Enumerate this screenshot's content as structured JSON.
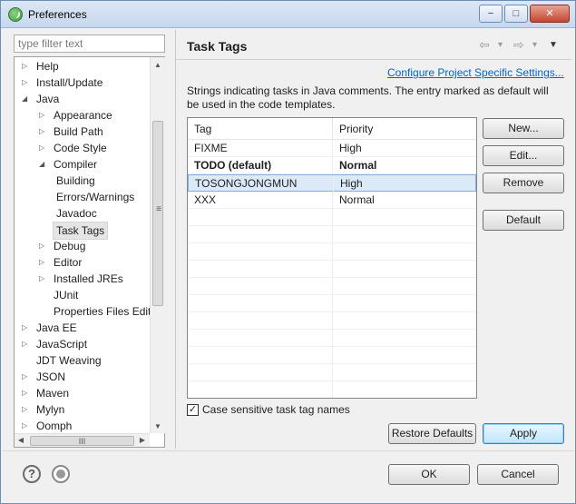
{
  "window": {
    "title": "Preferences"
  },
  "left_pane": {
    "filter_placeholder": "type filter text",
    "tree": [
      {
        "label": "Help",
        "arrow": "▷",
        "level": 0
      },
      {
        "label": "Install/Update",
        "arrow": "▷",
        "level": 0
      },
      {
        "label": "Java",
        "arrow": "◢",
        "level": 0
      },
      {
        "label": "Appearance",
        "arrow": "▷",
        "level": 1
      },
      {
        "label": "Build Path",
        "arrow": "▷",
        "level": 1
      },
      {
        "label": "Code Style",
        "arrow": "▷",
        "level": 1
      },
      {
        "label": "Compiler",
        "arrow": "◢",
        "level": 1
      },
      {
        "label": "Building",
        "arrow": "",
        "level": 2
      },
      {
        "label": "Errors/Warnings",
        "arrow": "",
        "level": 2
      },
      {
        "label": "Javadoc",
        "arrow": "",
        "level": 2
      },
      {
        "label": "Task Tags",
        "arrow": "",
        "level": 2,
        "selected": true
      },
      {
        "label": "Debug",
        "arrow": "▷",
        "level": 1
      },
      {
        "label": "Editor",
        "arrow": "▷",
        "level": 1
      },
      {
        "label": "Installed JREs",
        "arrow": "▷",
        "level": 1
      },
      {
        "label": "JUnit",
        "arrow": "",
        "level": 1
      },
      {
        "label": "Properties Files Edito",
        "arrow": "",
        "level": 1
      },
      {
        "label": "Java EE",
        "arrow": "▷",
        "level": 0
      },
      {
        "label": "JavaScript",
        "arrow": "▷",
        "level": 0
      },
      {
        "label": "JDT Weaving",
        "arrow": "",
        "level": 0
      },
      {
        "label": "JSON",
        "arrow": "▷",
        "level": 0
      },
      {
        "label": "Maven",
        "arrow": "▷",
        "level": 0
      },
      {
        "label": "Mylyn",
        "arrow": "▷",
        "level": 0
      },
      {
        "label": "Oomph",
        "arrow": "▷",
        "level": 0
      }
    ],
    "hscroll_grip": "III",
    "vscroll_grip": "≡"
  },
  "page": {
    "title": "Task Tags",
    "config_link": "Configure Project Specific Settings...",
    "description": "Strings indicating tasks in Java comments. The entry marked as default will be used in the code templates.",
    "table": {
      "headers": {
        "tag": "Tag",
        "priority": "Priority"
      },
      "rows": [
        {
          "tag": "FIXME",
          "priority": "High",
          "bold": false,
          "selected": false
        },
        {
          "tag": "TODO (default)",
          "priority": "Normal",
          "bold": true,
          "selected": false
        },
        {
          "tag": "TOSONGJONGMUN",
          "priority": "High",
          "bold": false,
          "selected": true
        },
        {
          "tag": "XXX",
          "priority": "Normal",
          "bold": false,
          "selected": false
        }
      ]
    },
    "side_buttons": {
      "new": "New...",
      "edit": "Edit...",
      "remove": "Remove",
      "default": "Default"
    },
    "case_sensitive": {
      "label": "Case sensitive task tag names",
      "checked": true,
      "mark": "✓"
    },
    "restore_defaults": "Restore Defaults",
    "apply": "Apply"
  },
  "footer": {
    "help_icon": "?",
    "ok": "OK",
    "cancel": "Cancel"
  },
  "title_buttons": {
    "minimize": "−",
    "maximize": "□",
    "close": "✕"
  },
  "nav_icons": {
    "back": "⇦",
    "back_menu": "▾",
    "forward": "⇨",
    "forward_menu": "▾",
    "view_menu": "▼"
  }
}
